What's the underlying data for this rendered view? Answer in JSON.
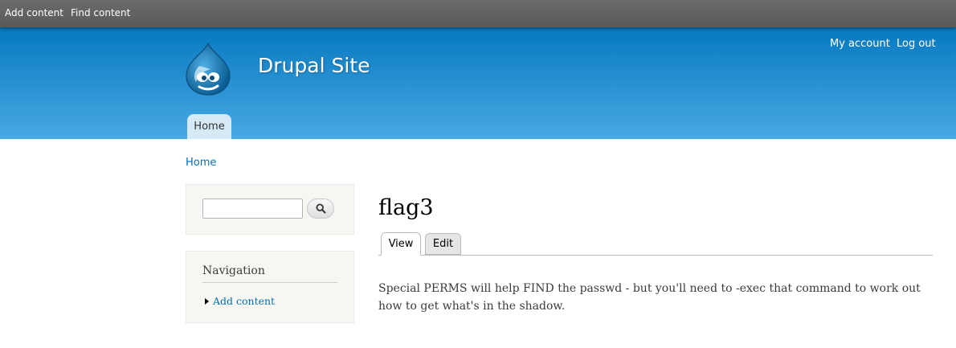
{
  "toolbar": {
    "add_content": "Add content",
    "find_content": "Find content"
  },
  "header": {
    "site_name": "Drupal Site",
    "logo_icon": "drupal-drop-logo-icon",
    "secondary_menu": {
      "my_account": "My account",
      "log_out": "Log out"
    },
    "main_menu": {
      "home": "Home"
    }
  },
  "breadcrumb": {
    "home": "Home"
  },
  "sidebar": {
    "search": {
      "input_value": "",
      "button_icon": "search-icon"
    },
    "navigation": {
      "title": "Navigation",
      "items": [
        {
          "label": "Add content"
        }
      ]
    }
  },
  "content": {
    "title": "flag3",
    "tabs": [
      {
        "label": "View",
        "active": true
      },
      {
        "label": "Edit",
        "active": false
      }
    ],
    "body": "Special PERMS will help FIND the passwd - but you'll need to -exec that command to work out how to get what's in the shadow."
  },
  "colors": {
    "header_top": "#0779bf",
    "header_bottom": "#48a9e4",
    "link": "#0071b3",
    "toolbar": "#666666"
  }
}
